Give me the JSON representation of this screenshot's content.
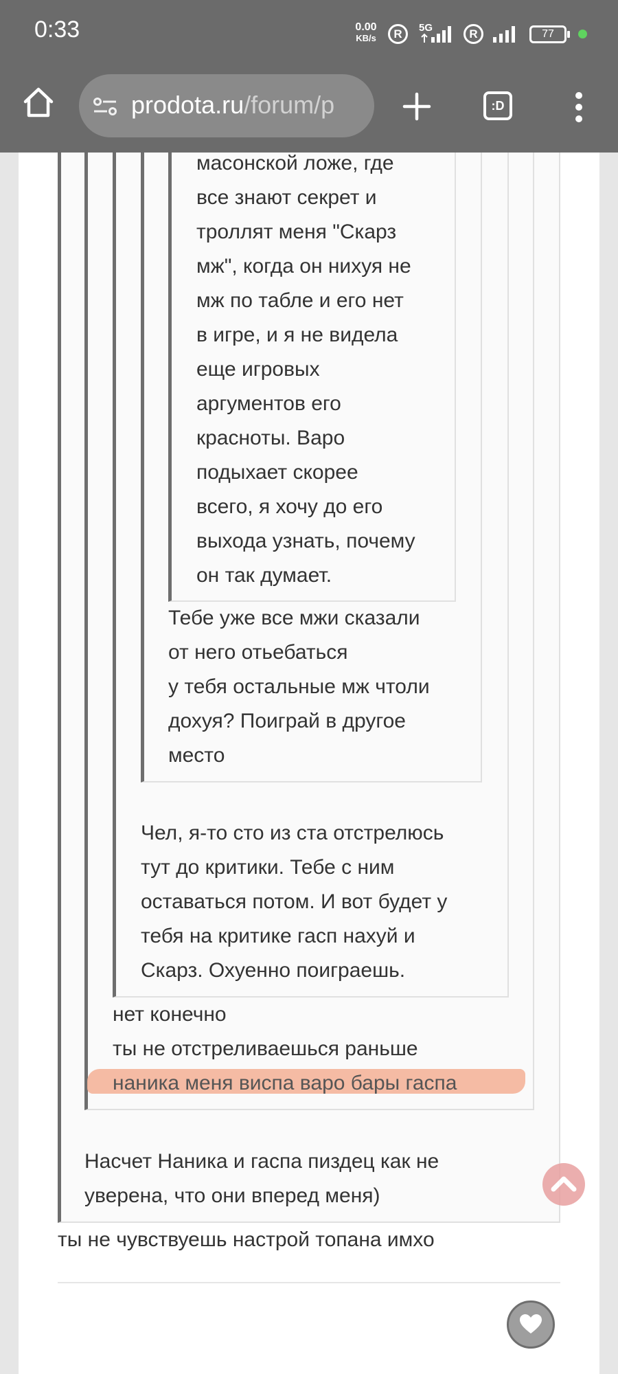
{
  "status": {
    "time": "0:33",
    "net_speed_value": "0.00",
    "net_speed_unit": "KB/s",
    "r_badge_1": "R",
    "network_type": "5G",
    "r_badge_2": "R",
    "battery_level": "77"
  },
  "browser": {
    "url_domain": "prodota.ru",
    "url_path": "/forum/p",
    "tab_label": ":D"
  },
  "thread": {
    "innermost_quote": {
      "lines": [
        "масонской ложе, где",
        "все знают секрет и",
        "троллят меня \"Скарз",
        "мж\", когда он нихуя не",
        "мж по табле и его нет",
        "в игре, и я не видела",
        "еще игровых",
        "аргументов его",
        "красноты. Варо",
        "подыхает скорее",
        "всего, я хочу до его",
        "выхода узнать, почему",
        "он так думает."
      ]
    },
    "reply_level4": {
      "lines": [
        "Тебе уже все мжи сказали",
        "от него отьебаться",
        "у тебя остальные мж чтоли",
        "дохуя? Поиграй в другое",
        "место"
      ]
    },
    "reply_level3": {
      "lines": [
        "Чел, я-то сто из ста отстрелюсь",
        "тут до критики. Тебе с ним",
        "оставаться потом. И вот будет у",
        "тебя на критике гасп нахуй и",
        "Скарз. Охуенно поиграешь."
      ]
    },
    "reply_level2": {
      "lines": [
        "нет конечно",
        "ты не отстреливаешься раньше",
        "наника меня виспа варо бары гаспа"
      ]
    },
    "reply_level1": {
      "lines": [
        "Насчет Наника и гаспа пиздец как не",
        "уверена, что они вперед меня)"
      ]
    },
    "post_text": "ты не чувствуешь настрой топана имхо"
  },
  "colors": {
    "browser_chrome": "#6b6b6b",
    "highlight": "#f4b49a",
    "scroll_top_button": "#e8a0a0",
    "quote_border": "#6e6e6e"
  },
  "icons": {
    "home": "home-icon",
    "site_settings": "site-settings-icon",
    "new_tab": "plus-icon",
    "tabs": "tabs-icon",
    "menu": "more-vert-icon",
    "scroll_top": "chevron-up-icon",
    "like": "heart-icon"
  }
}
